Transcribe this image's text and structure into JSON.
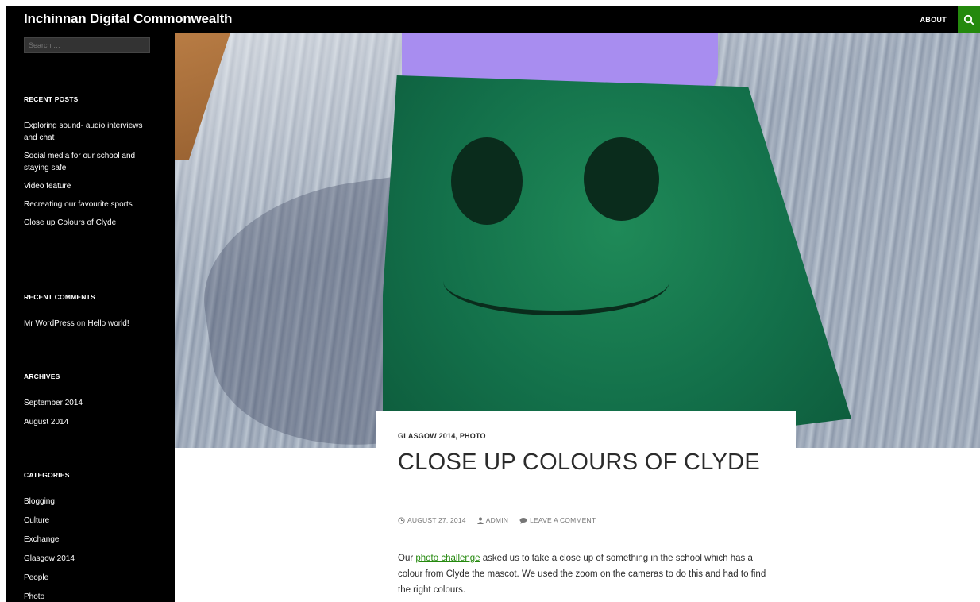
{
  "header": {
    "site_title": "Inchinnan Digital Commonwealth",
    "nav_about": "ABOUT",
    "accent_color": "#24890d"
  },
  "sidebar": {
    "search_placeholder": "Search …",
    "recent_posts": {
      "title": "RECENT POSTS",
      "items": [
        "Exploring sound- audio interviews and chat",
        "Social media for our school and staying safe",
        "Video feature",
        "Recreating our favourite sports",
        "Close up Colours of Clyde"
      ]
    },
    "recent_comments": {
      "title": "RECENT COMMENTS",
      "author": "Mr WordPress",
      "on": "on",
      "post": "Hello world!"
    },
    "archives": {
      "title": "ARCHIVES",
      "items": [
        "September 2014",
        "August 2014"
      ]
    },
    "categories": {
      "title": "CATEGORIES",
      "items": [
        "Blogging",
        "Culture",
        "Exchange",
        "Glasgow 2014",
        "People",
        "Photo"
      ]
    }
  },
  "article": {
    "categories": [
      "GLASGOW 2014",
      "PHOTO"
    ],
    "category_separator": ", ",
    "title": "CLOSE UP COLOURS OF CLYDE",
    "meta": {
      "date": "AUGUST 27, 2014",
      "author": "ADMIN",
      "comments": "LEAVE A COMMENT"
    },
    "body_link": "photo challenge",
    "body_before": "Our ",
    "body_after": " asked us to take a close up of something in the school which has a colour from Clyde the mascot.  We used the zoom on the cameras to do this and had to find the right colours."
  },
  "icons": {
    "search": "search-icon",
    "clock": "clock-icon",
    "user": "user-icon",
    "comment": "comment-icon"
  }
}
